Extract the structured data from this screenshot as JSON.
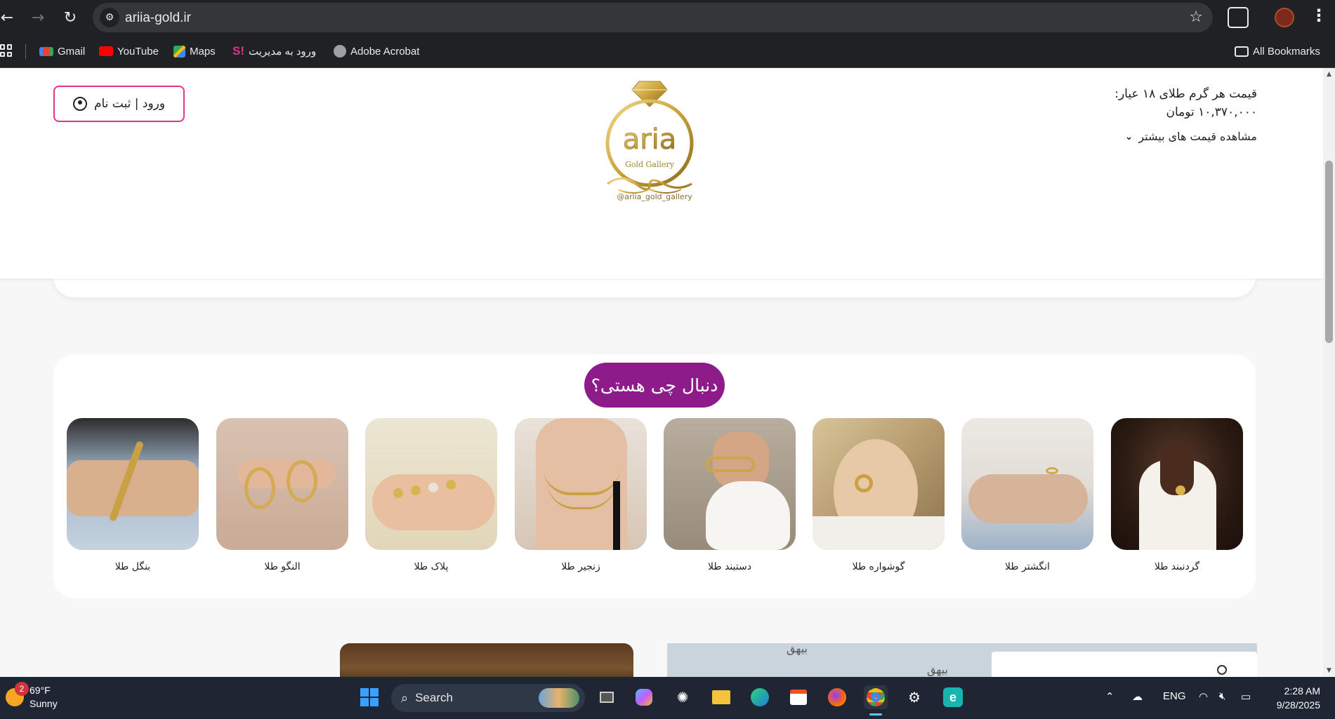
{
  "browser": {
    "url": "ariia-gold.ir",
    "bookmarks": [
      {
        "label": "Gmail",
        "icon": "gmail-icon"
      },
      {
        "label": "YouTube",
        "icon": "youtube-icon"
      },
      {
        "label": "Maps",
        "icon": "maps-icon"
      },
      {
        "label": "ورود به مدیریت",
        "icon": "site-admin-icon"
      },
      {
        "label": "Adobe Acrobat",
        "icon": "globe-icon"
      }
    ],
    "all_bookmarks": "All Bookmarks"
  },
  "header": {
    "login_label": "ورود | ثبت نام",
    "logo_handle": "@ariia_gold_gallery",
    "logo_name": "aria",
    "logo_sub": "Gold Gallery",
    "price_title": "قیمت هر گرم طلای ۱۸ عیار:",
    "price_value": "۱۰,۳۷۰,۰۰۰ تومان",
    "more_prices": "مشاهده قیمت های بیشتر"
  },
  "categories": {
    "title": "دنبال چی هستی؟",
    "items": [
      {
        "label": "گردنبند طلا"
      },
      {
        "label": "انگشتر طلا"
      },
      {
        "label": "گوشواره طلا"
      },
      {
        "label": "دستبند طلا"
      },
      {
        "label": "زنجیر طلا"
      },
      {
        "label": "پلاک طلا"
      },
      {
        "label": "النگو طلا"
      },
      {
        "label": "بنگل طلا"
      }
    ]
  },
  "map_labels": [
    "بیهق",
    "بیهق"
  ],
  "taskbar": {
    "weather_temp": "69°F",
    "weather_desc": "Sunny",
    "weather_badge": "2",
    "search_label": "Search",
    "language": "ENG",
    "time": "2:28 AM",
    "date": "9/28/2025"
  },
  "colors": {
    "brand_purple": "#8e1b8a",
    "login_border": "#e6328f",
    "gold": "#c9a13a"
  }
}
